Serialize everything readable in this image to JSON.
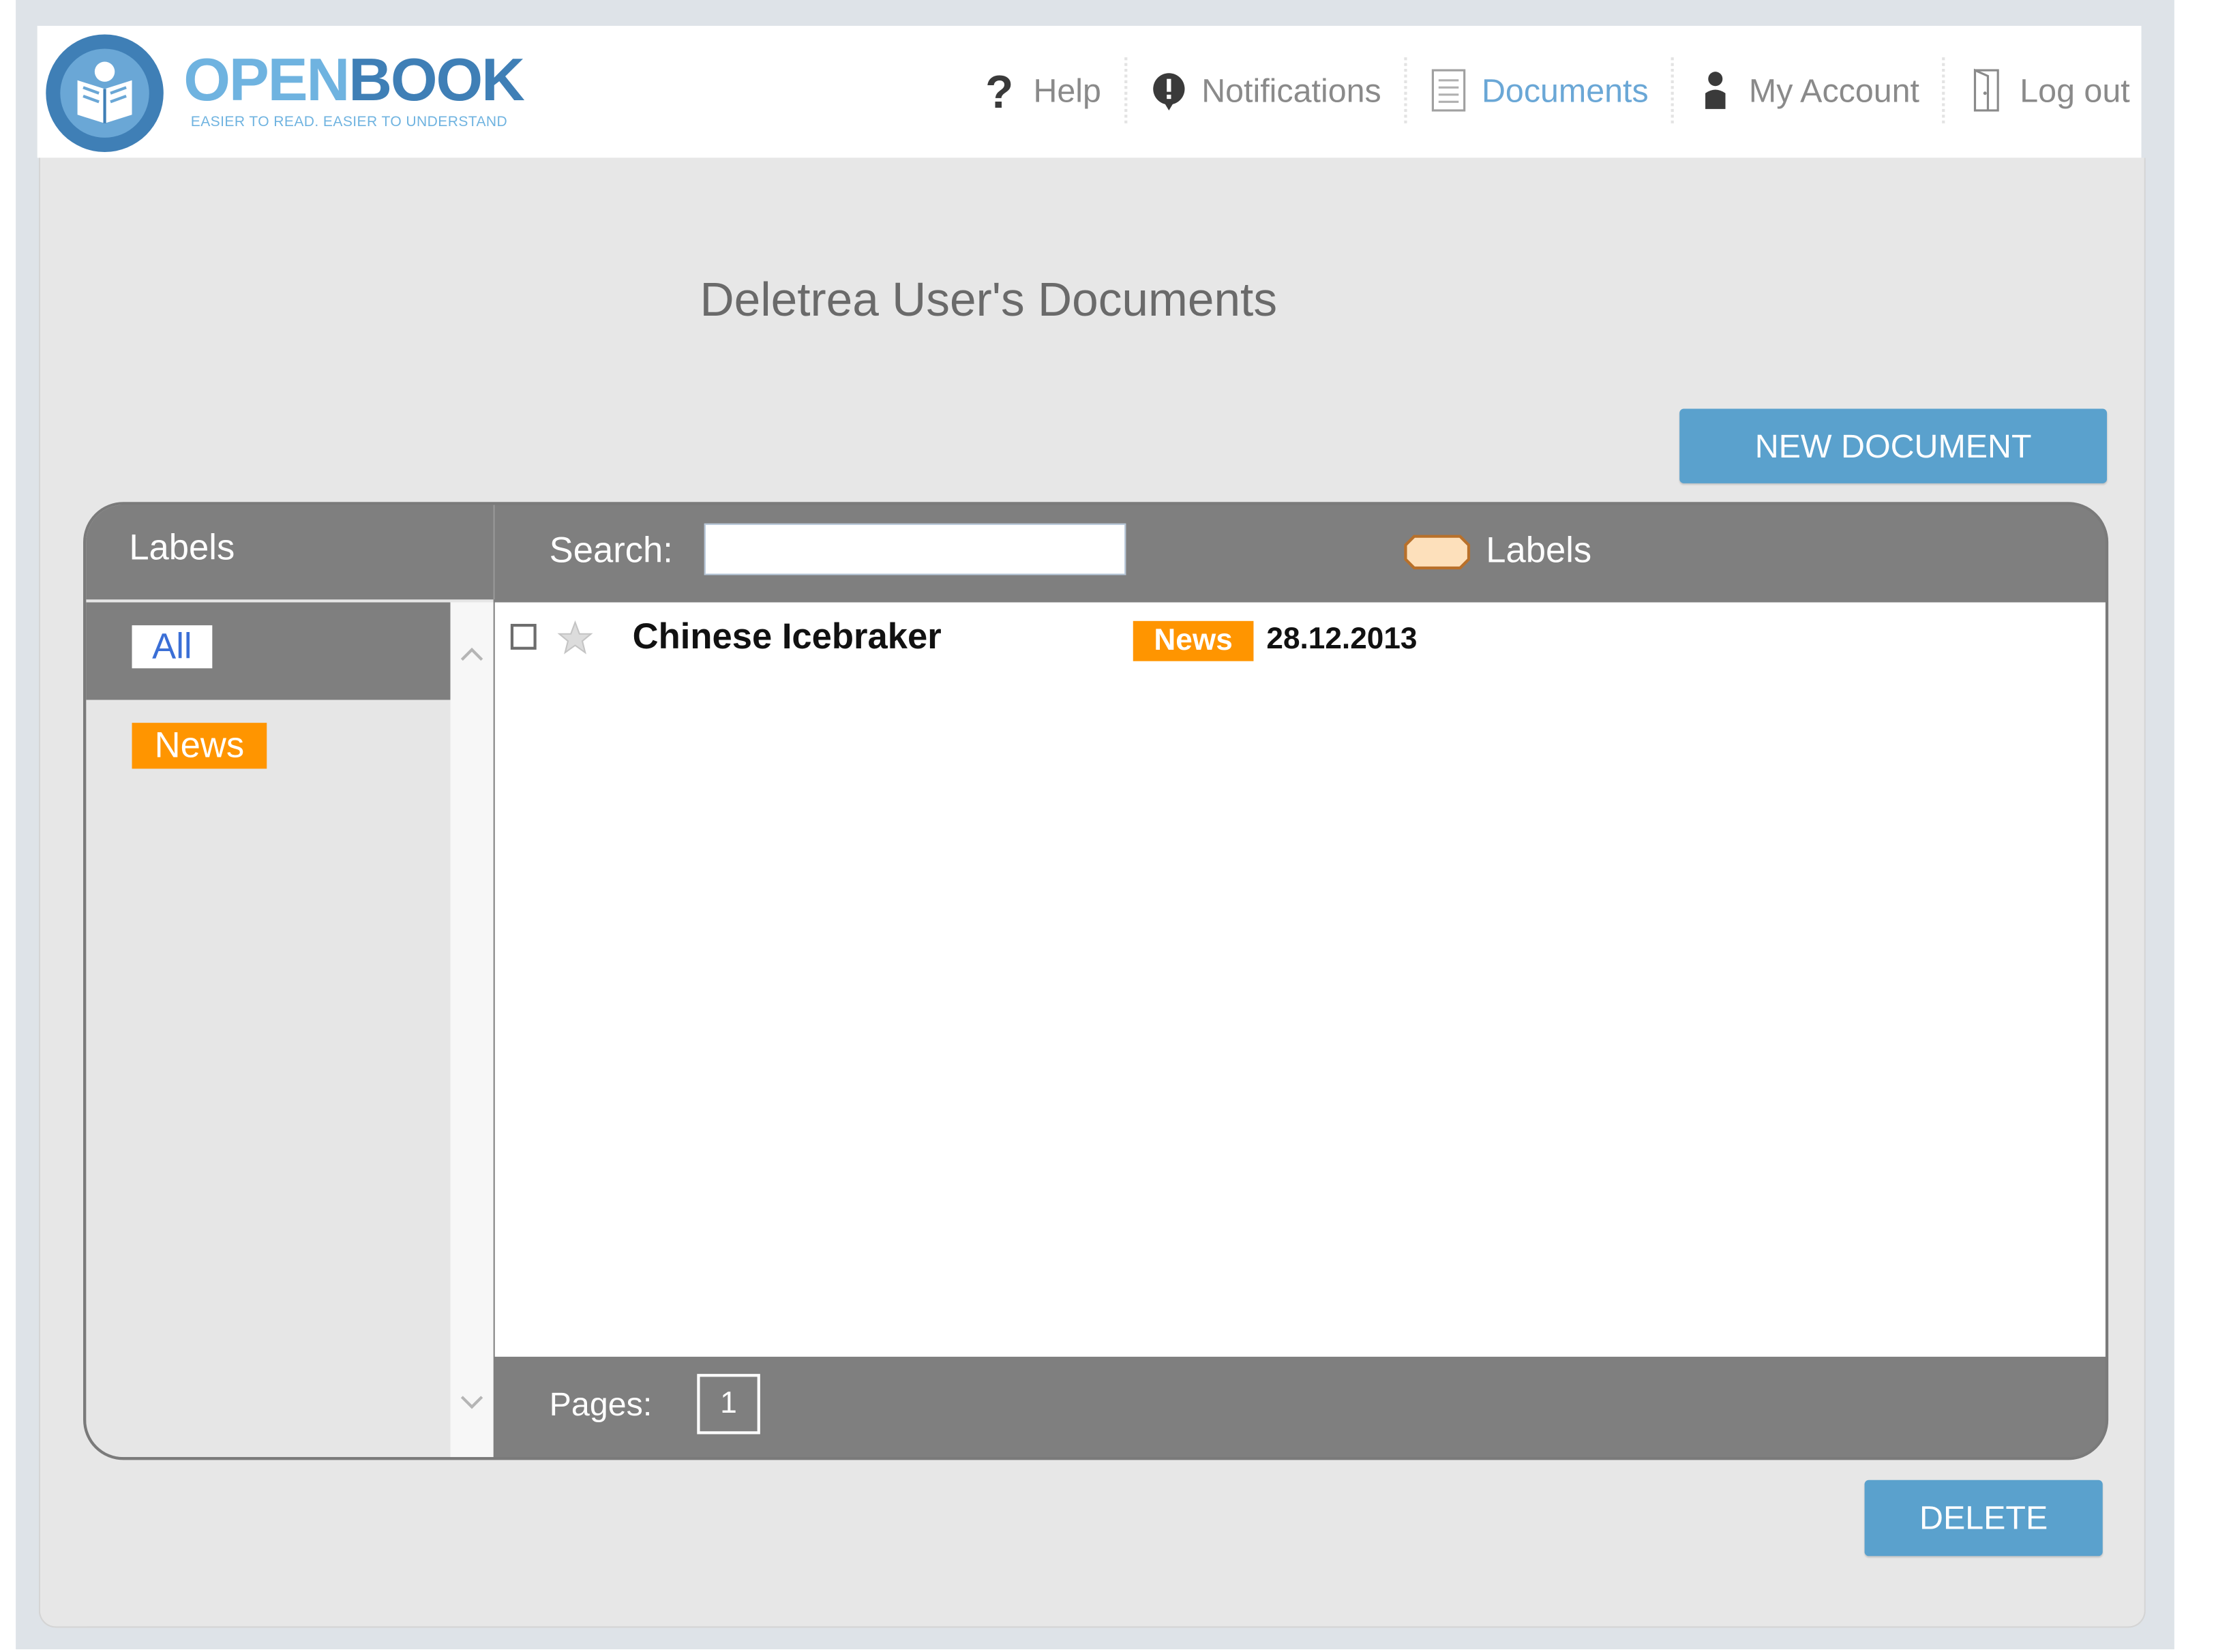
{
  "header": {
    "logo_open": "OPEN",
    "logo_book": "BOOK",
    "logo_tagline": "EASIER TO READ. EASIER TO UNDERSTAND",
    "nav": [
      {
        "label": "Help",
        "icon": "question-icon"
      },
      {
        "label": "Notifications",
        "icon": "alert-icon"
      },
      {
        "label": "Documents",
        "icon": "document-icon",
        "active": true
      },
      {
        "label": "My Account",
        "icon": "user-icon"
      },
      {
        "label": "Log out",
        "icon": "door-icon"
      }
    ]
  },
  "main": {
    "title": "Deletrea User's Documents",
    "new_document_label": "NEW DOCUMENT",
    "delete_label": "DELETE"
  },
  "labels_panel": {
    "heading": "Labels",
    "items": [
      {
        "label": "All",
        "selected": true
      },
      {
        "label": "News",
        "color": "#ff9500"
      }
    ]
  },
  "documents": {
    "search_label": "Search:",
    "search_value": "",
    "labels_filter": "Labels",
    "rows": [
      {
        "title": "Chinese Icebraker",
        "tag": "News",
        "date": "28.12.2013",
        "checked": false,
        "starred": false
      }
    ],
    "pages_label": "Pages:",
    "pages": [
      "1"
    ]
  },
  "colors": {
    "accent": "#5aa1cd",
    "tag": "#ff9500",
    "panel": "#7f7f7f"
  }
}
